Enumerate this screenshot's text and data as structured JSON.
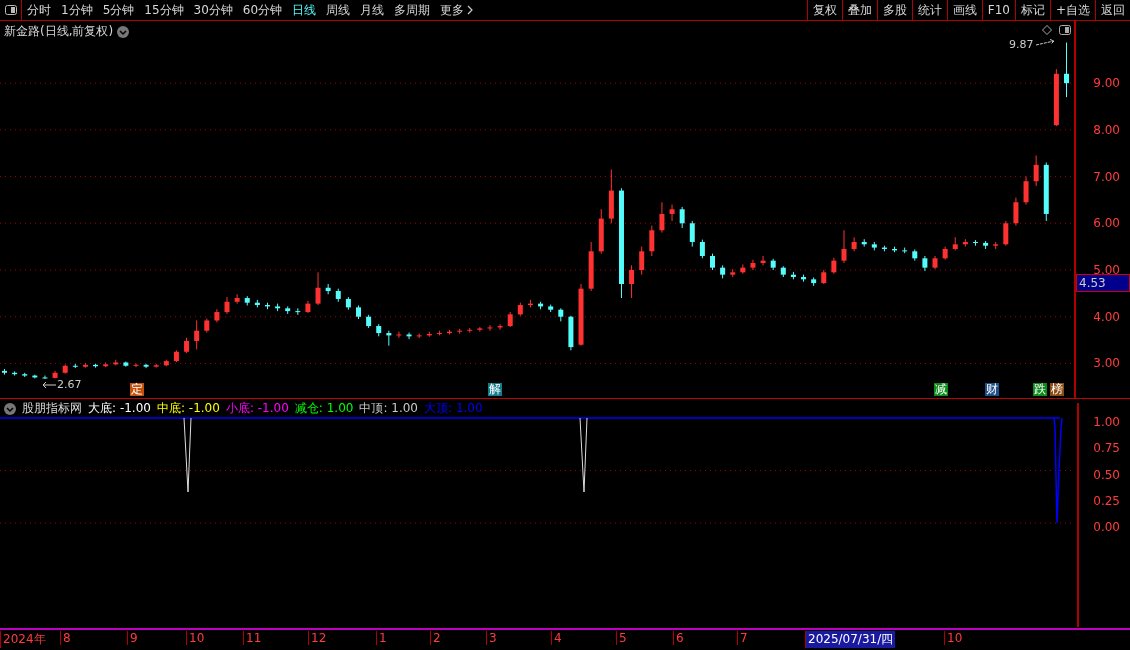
{
  "toolbar": {
    "periods": [
      {
        "label": "分时",
        "selected": false
      },
      {
        "label": "1分钟",
        "selected": false
      },
      {
        "label": "5分钟",
        "selected": false
      },
      {
        "label": "15分钟",
        "selected": false
      },
      {
        "label": "30分钟",
        "selected": false
      },
      {
        "label": "60分钟",
        "selected": false
      },
      {
        "label": "日线",
        "selected": true
      },
      {
        "label": "周线",
        "selected": false
      },
      {
        "label": "月线",
        "selected": false
      },
      {
        "label": "多周期",
        "selected": false
      },
      {
        "label": "更多",
        "selected": false
      }
    ],
    "buttons": [
      "复权",
      "叠加",
      "多股",
      "统计",
      "画线",
      "F10",
      "标记",
      "+自选",
      "返回"
    ]
  },
  "chart": {
    "title": "新金路(日线,前复权)",
    "high_label": "9.87",
    "low_label": "2.67",
    "current_price": "4.53",
    "chart_data": {
      "type": "candlestick",
      "grid": true,
      "ylim": [
        2.26,
        10.33
      ],
      "yticks": [
        {
          "value": 9,
          "label": "9.00"
        },
        {
          "value": 8,
          "label": "8.00"
        },
        {
          "value": 7,
          "label": "7.00"
        },
        {
          "value": 6,
          "label": "6.00"
        },
        {
          "value": 5,
          "label": "5.00"
        },
        {
          "value": 4,
          "label": "4.00"
        },
        {
          "value": 3,
          "label": "3.00"
        }
      ],
      "ohlc": [
        [
          2.84,
          2.88,
          2.76,
          2.8
        ],
        [
          2.8,
          2.83,
          2.74,
          2.77
        ],
        [
          2.77,
          2.8,
          2.71,
          2.74
        ],
        [
          2.74,
          2.76,
          2.68,
          2.7
        ],
        [
          2.7,
          2.74,
          2.67,
          2.68
        ],
        [
          2.69,
          2.84,
          2.68,
          2.8
        ],
        [
          2.8,
          2.98,
          2.78,
          2.95
        ],
        [
          2.95,
          2.99,
          2.9,
          2.93
        ],
        [
          2.93,
          3.01,
          2.91,
          2.97
        ],
        [
          2.97,
          2.99,
          2.91,
          2.94
        ],
        [
          2.94,
          3.02,
          2.92,
          2.98
        ],
        [
          2.98,
          3.08,
          2.96,
          3.02
        ],
        [
          3.02,
          3.04,
          2.93,
          2.95
        ],
        [
          2.95,
          3.0,
          2.92,
          2.97
        ],
        [
          2.97,
          2.99,
          2.9,
          2.93
        ],
        [
          2.93,
          2.99,
          2.91,
          2.96
        ],
        [
          2.96,
          3.08,
          2.94,
          3.05
        ],
        [
          3.05,
          3.28,
          3.03,
          3.25
        ],
        [
          3.25,
          3.55,
          3.22,
          3.48
        ],
        [
          3.48,
          3.92,
          3.3,
          3.7
        ],
        [
          3.7,
          3.96,
          3.66,
          3.92
        ],
        [
          3.92,
          4.16,
          3.88,
          4.1
        ],
        [
          4.1,
          4.42,
          4.06,
          4.32
        ],
        [
          4.32,
          4.48,
          4.28,
          4.4
        ],
        [
          4.4,
          4.44,
          4.24,
          4.3
        ],
        [
          4.3,
          4.36,
          4.2,
          4.25
        ],
        [
          4.25,
          4.3,
          4.16,
          4.22
        ],
        [
          4.22,
          4.28,
          4.12,
          4.18
        ],
        [
          4.18,
          4.22,
          4.06,
          4.12
        ],
        [
          4.12,
          4.18,
          4.04,
          4.1
        ],
        [
          4.1,
          4.34,
          4.08,
          4.28
        ],
        [
          4.28,
          4.95,
          4.25,
          4.62
        ],
        [
          4.62,
          4.7,
          4.48,
          4.55
        ],
        [
          4.55,
          4.6,
          4.32,
          4.38
        ],
        [
          4.38,
          4.42,
          4.15,
          4.2
        ],
        [
          4.2,
          4.24,
          3.95,
          4.0
        ],
        [
          4.0,
          4.04,
          3.76,
          3.8
        ],
        [
          3.8,
          3.84,
          3.58,
          3.65
        ],
        [
          3.65,
          3.7,
          3.38,
          3.6
        ],
        [
          3.6,
          3.68,
          3.55,
          3.62
        ],
        [
          3.62,
          3.66,
          3.52,
          3.58
        ],
        [
          3.58,
          3.64,
          3.54,
          3.6
        ],
        [
          3.6,
          3.68,
          3.57,
          3.63
        ],
        [
          3.63,
          3.7,
          3.6,
          3.65
        ],
        [
          3.65,
          3.72,
          3.62,
          3.68
        ],
        [
          3.68,
          3.74,
          3.64,
          3.7
        ],
        [
          3.7,
          3.76,
          3.66,
          3.72
        ],
        [
          3.72,
          3.78,
          3.68,
          3.75
        ],
        [
          3.75,
          3.82,
          3.7,
          3.77
        ],
        [
          3.77,
          3.84,
          3.72,
          3.8
        ],
        [
          3.8,
          4.1,
          3.78,
          4.05
        ],
        [
          4.05,
          4.3,
          4.02,
          4.25
        ],
        [
          4.25,
          4.36,
          4.2,
          4.28
        ],
        [
          4.28,
          4.32,
          4.16,
          4.22
        ],
        [
          4.22,
          4.26,
          4.1,
          4.15
        ],
        [
          4.15,
          4.18,
          3.9,
          4.0
        ],
        [
          4.0,
          4.02,
          3.28,
          3.35
        ],
        [
          3.4,
          4.7,
          3.38,
          4.6
        ],
        [
          4.6,
          5.6,
          4.55,
          5.4
        ],
        [
          5.4,
          6.3,
          5.35,
          6.1
        ],
        [
          6.1,
          7.15,
          6.0,
          6.7
        ],
        [
          6.7,
          6.75,
          4.4,
          4.7
        ],
        [
          4.7,
          5.1,
          4.4,
          5.0
        ],
        [
          5.0,
          5.5,
          4.9,
          5.4
        ],
        [
          5.4,
          5.95,
          5.3,
          5.85
        ],
        [
          5.85,
          6.45,
          5.8,
          6.2
        ],
        [
          6.2,
          6.4,
          6.05,
          6.3
        ],
        [
          6.3,
          6.35,
          5.9,
          6.0
        ],
        [
          6.0,
          6.05,
          5.5,
          5.6
        ],
        [
          5.6,
          5.65,
          5.25,
          5.3
        ],
        [
          5.3,
          5.35,
          5.0,
          5.05
        ],
        [
          5.05,
          5.1,
          4.82,
          4.9
        ],
        [
          4.9,
          5.02,
          4.85,
          4.95
        ],
        [
          4.95,
          5.12,
          4.92,
          5.05
        ],
        [
          5.05,
          5.22,
          5.0,
          5.15
        ],
        [
          5.15,
          5.3,
          5.1,
          5.2
        ],
        [
          5.2,
          5.24,
          5.0,
          5.05
        ],
        [
          5.05,
          5.08,
          4.85,
          4.9
        ],
        [
          4.9,
          4.96,
          4.8,
          4.85
        ],
        [
          4.85,
          4.9,
          4.75,
          4.8
        ],
        [
          4.8,
          4.84,
          4.66,
          4.72
        ],
        [
          4.72,
          5.0,
          4.7,
          4.95
        ],
        [
          4.95,
          5.26,
          4.92,
          5.2
        ],
        [
          5.2,
          5.85,
          5.15,
          5.45
        ],
        [
          5.45,
          5.7,
          5.4,
          5.6
        ],
        [
          5.6,
          5.66,
          5.5,
          5.55
        ],
        [
          5.55,
          5.6,
          5.42,
          5.48
        ],
        [
          5.48,
          5.52,
          5.4,
          5.45
        ],
        [
          5.45,
          5.5,
          5.38,
          5.42
        ],
        [
          5.42,
          5.48,
          5.36,
          5.4
        ],
        [
          5.4,
          5.44,
          5.2,
          5.25
        ],
        [
          5.25,
          5.3,
          4.98,
          5.05
        ],
        [
          5.05,
          5.3,
          5.02,
          5.25
        ],
        [
          5.25,
          5.5,
          5.22,
          5.45
        ],
        [
          5.45,
          5.7,
          5.42,
          5.55
        ],
        [
          5.55,
          5.66,
          5.5,
          5.6
        ],
        [
          5.6,
          5.64,
          5.52,
          5.58
        ],
        [
          5.58,
          5.62,
          5.45,
          5.52
        ],
        [
          5.52,
          5.6,
          5.45,
          5.55
        ],
        [
          5.55,
          6.05,
          5.52,
          6.0
        ],
        [
          6.0,
          6.55,
          5.95,
          6.45
        ],
        [
          6.45,
          7.0,
          6.4,
          6.9
        ],
        [
          6.9,
          7.45,
          6.8,
          7.25
        ],
        [
          7.25,
          7.3,
          6.05,
          6.2
        ],
        [
          8.1,
          9.3,
          8.08,
          9.2
        ],
        [
          9.2,
          9.87,
          8.7,
          9.0
        ]
      ]
    },
    "event_tags": [
      {
        "label": "定",
        "color": "#c4500e"
      },
      {
        "label": "解",
        "color": "#127c8c"
      },
      {
        "label": "减",
        "color": "#0c8a1c"
      },
      {
        "label": "财",
        "color": "#1c4e88"
      },
      {
        "label": "跌",
        "color": "#0c8a1c"
      },
      {
        "label": "榜",
        "color": "#8a4c12"
      }
    ]
  },
  "indicator": {
    "name": "股朋指标网",
    "readings": [
      {
        "label": "大底:",
        "value": "-1.00",
        "color": "#ffffff"
      },
      {
        "label": "中底:",
        "value": "-1.00",
        "color": "#ffff00"
      },
      {
        "label": "小底:",
        "value": "-1.00",
        "color": "#ff00ff"
      },
      {
        "label": "减仓:",
        "value": "1.00",
        "color": "#00ff00"
      },
      {
        "label": "中顶:",
        "value": "1.00",
        "color": "#c8c8c8"
      },
      {
        "label": "大顶:",
        "value": "1.00",
        "color": "#0000ff"
      }
    ],
    "ticks": [
      "1.00",
      "0.75",
      "0.50",
      "0.25",
      "0.00"
    ]
  },
  "date_axis": {
    "labels": [
      {
        "label": "2024年",
        "selected": false
      },
      {
        "label": "8",
        "selected": false
      },
      {
        "label": "9",
        "selected": false
      },
      {
        "label": "10",
        "selected": false
      },
      {
        "label": "11",
        "selected": false
      },
      {
        "label": "12",
        "selected": false
      },
      {
        "label": "1",
        "selected": false
      },
      {
        "label": "2",
        "selected": false
      },
      {
        "label": "3",
        "selected": false
      },
      {
        "label": "4",
        "selected": false
      },
      {
        "label": "5",
        "selected": false
      },
      {
        "label": "6",
        "selected": false
      },
      {
        "label": "7",
        "selected": false
      },
      {
        "label": "2025/07/31/四",
        "selected": true
      },
      {
        "label": "10",
        "selected": false
      }
    ]
  }
}
